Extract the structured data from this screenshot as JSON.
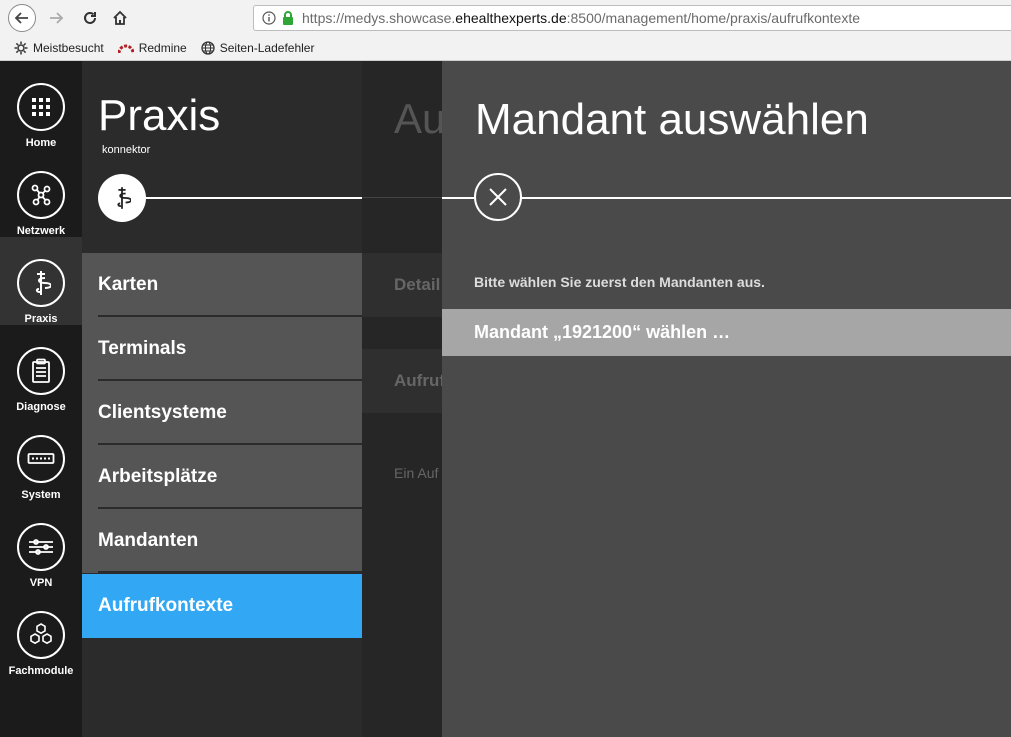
{
  "browser": {
    "url_prefix": "https://medys.showcase.",
    "url_host": "ehealthexperts.de",
    "url_path": ":8500/management/home/praxis/aufrufkontexte",
    "bookmarks": [
      {
        "label": "Meistbesucht",
        "icon": "gear-icon"
      },
      {
        "label": "Redmine",
        "icon": "redmine-icon"
      },
      {
        "label": "Seiten-Ladefehler",
        "icon": "globe-icon"
      }
    ]
  },
  "sidebar": {
    "items": [
      {
        "label": "Home",
        "icon": "grid-icon"
      },
      {
        "label": "Netzwerk",
        "icon": "network-icon"
      },
      {
        "label": "Praxis",
        "icon": "caduceus-icon",
        "active": true
      },
      {
        "label": "Diagnose",
        "icon": "clipboard-icon"
      },
      {
        "label": "System",
        "icon": "server-icon"
      },
      {
        "label": "VPN",
        "icon": "vpn-icon"
      },
      {
        "label": "Fachmodule",
        "icon": "hexagons-icon"
      }
    ]
  },
  "section": {
    "title": "Praxis",
    "subtitle": "konnektor",
    "menu": [
      {
        "label": "Karten"
      },
      {
        "label": "Terminals"
      },
      {
        "label": "Clientsysteme"
      },
      {
        "label": "Arbeitsplätze"
      },
      {
        "label": "Mandanten"
      },
      {
        "label": "Aufrufkontexte",
        "active": true
      }
    ]
  },
  "content": {
    "title_fragment": "Au",
    "row1_fragment": "Detail",
    "row2_fragment": "Aufruf",
    "text_fragment": "Ein Auf"
  },
  "modal": {
    "title": "Mandant auswählen",
    "instruction": "Bitte wählen Sie zuerst den Mandanten aus.",
    "option": "Mandant „1921200“ wählen …"
  },
  "colors": {
    "accent": "#32a8f5",
    "modal_bg": "#4a4a4a",
    "option_bg": "#a6a6a6",
    "menu_bg": "#555555"
  }
}
